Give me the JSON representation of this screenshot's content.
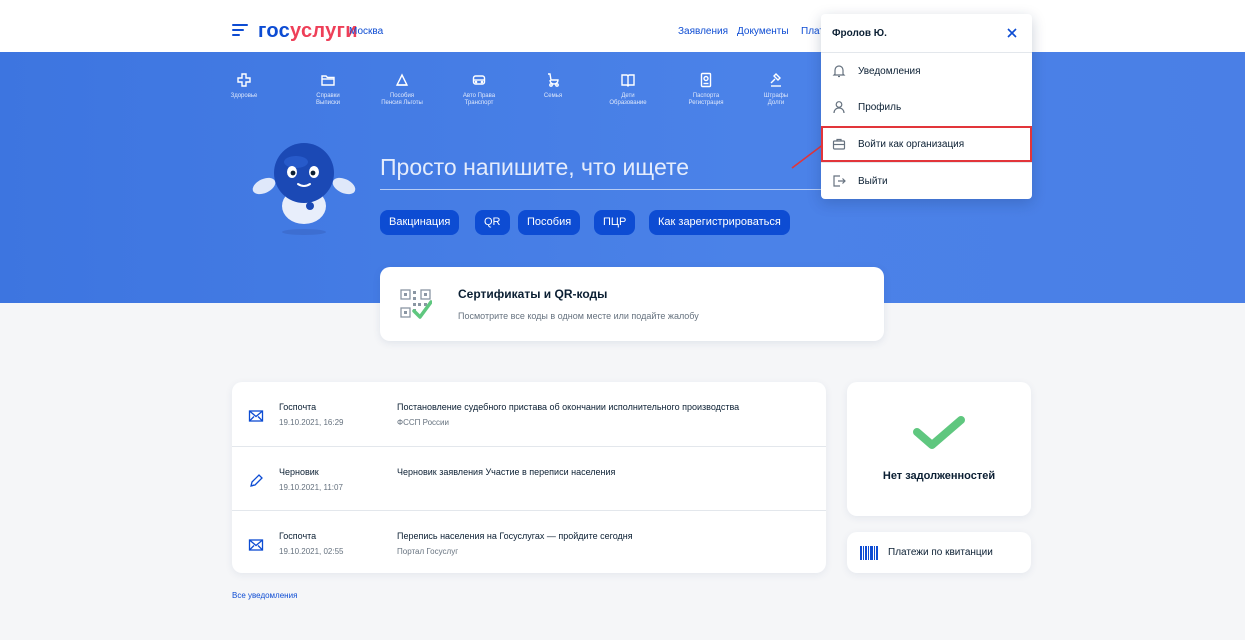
{
  "header": {
    "logo_part1": "гос",
    "logo_part2": "услуги",
    "city": "Москва",
    "nav_applications": "Заявления",
    "nav_documents": "Документы",
    "nav_payments_cut": "Плат"
  },
  "categories": [
    {
      "line1": "Здоровье",
      "line2": "",
      "icon": "health-icon"
    },
    {
      "line1": "Справки",
      "line2": "Выписки",
      "icon": "folder-icon"
    },
    {
      "line1": "Пособия",
      "line2": "Пенсия Льготы",
      "icon": "benefit-icon"
    },
    {
      "line1": "Авто Права",
      "line2": "Транспорт",
      "icon": "car-icon"
    },
    {
      "line1": "Семья",
      "line2": "",
      "icon": "stroller-icon"
    },
    {
      "line1": "Дети",
      "line2": "Образование",
      "icon": "book-icon"
    },
    {
      "line1": "Паспорта",
      "line2": "Регистрация",
      "icon": "passport-icon"
    },
    {
      "line1": "Штрафы",
      "line2": "Долги",
      "icon": "gavel-icon"
    }
  ],
  "search": {
    "placeholder": "Просто напишите, что ищете",
    "chips": [
      "Вакцинация",
      "QR",
      "Пособия",
      "ПЦР",
      "Как зарегистрироваться"
    ]
  },
  "certificates": {
    "title": "Сертификаты и QR-коды",
    "subtitle": "Посмотрите все коды в одном месте или подайте жалобу"
  },
  "notifications": [
    {
      "source": "Госпочта",
      "date": "19.10.2021, 16:29",
      "title": "Постановление судебного пристава об окончании исполнительного производства",
      "subtitle": "ФССП России",
      "icon": "mail-icon"
    },
    {
      "source": "Черновик",
      "date": "19.10.2021, 11:07",
      "title": "Черновик заявления Участие в переписи населения",
      "subtitle": "",
      "icon": "pencil-icon"
    },
    {
      "source": "Госпочта",
      "date": "19.10.2021, 02:55",
      "title": "Перепись населения на Госуслугах — пройдите сегодня",
      "subtitle": "Портал Госуслуг",
      "icon": "mail-icon"
    }
  ],
  "all_notifications": "Все уведомления",
  "debt": {
    "text": "Нет задолженностей"
  },
  "payments": {
    "text": "Платежи по квитанции"
  },
  "user_menu": {
    "user_name": "Фролов Ю.",
    "items": [
      {
        "label": "Уведомления",
        "icon": "bell-icon"
      },
      {
        "label": "Профиль",
        "icon": "user-icon"
      },
      {
        "label": "Войти как организация",
        "icon": "briefcase-icon"
      },
      {
        "label": "Выйти",
        "icon": "logout-icon"
      }
    ]
  },
  "colors": {
    "brand_blue": "#0d4cd3",
    "brand_red": "#ee3f58",
    "hero_blue": "#4b82e8",
    "success_green": "#5fc77f",
    "highlight_red": "#e2353a"
  }
}
